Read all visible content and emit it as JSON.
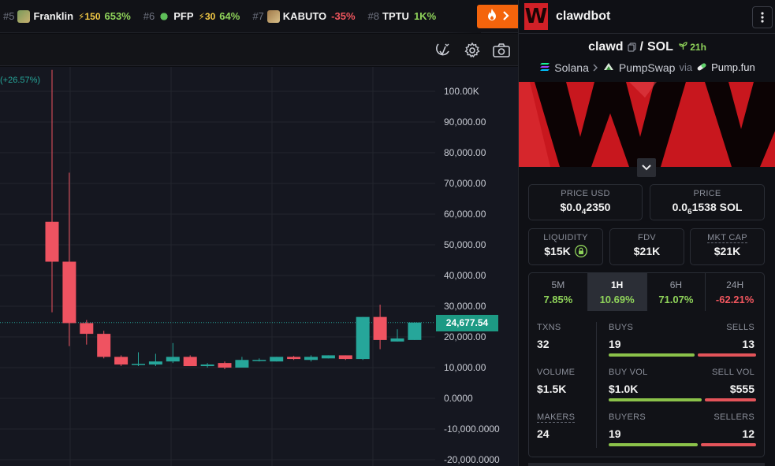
{
  "ticker": {
    "items": [
      {
        "rank": "#5",
        "name": "Franklin",
        "boost": "⚡150",
        "change": "653%",
        "dir": "up",
        "img": "a"
      },
      {
        "rank": "#6",
        "name": "PFP",
        "boost": "⚡30",
        "change": "64%",
        "dir": "up",
        "img": "b"
      },
      {
        "rank": "#7",
        "name": "KABUTO",
        "boost": "",
        "change": "-35%",
        "dir": "down",
        "img": "c"
      },
      {
        "rank": "#8",
        "name": "TPTU",
        "boost": "",
        "change": "1K%",
        "dir": "up",
        "img": ""
      }
    ],
    "trending_icon": "flame-icon",
    "arrow_icon": "chevron-right-icon"
  },
  "toolbar": {
    "icons": [
      "indicator-icon",
      "gear-icon",
      "camera-icon"
    ]
  },
  "chart": {
    "change_label": "(+26.57%)",
    "last_price_label": "24,677.54",
    "colors": {
      "up": "#26a69a",
      "down": "#ef5361",
      "bg": "#151720",
      "grid": "#22252e"
    }
  },
  "chart_data": {
    "type": "candlestick",
    "y_ticks": [
      "100.00K",
      "90,000.00",
      "80,000.00",
      "70,000.00",
      "60,000.00",
      "50,000.00",
      "40,000.00",
      "30,000.00",
      "20,000.00",
      "10,000.00",
      "0.0000",
      "-10,000.0000",
      "-20,000.0000"
    ],
    "y_tick_values": [
      100000,
      90000,
      80000,
      70000,
      60000,
      50000,
      40000,
      30000,
      20000,
      10000,
      0,
      -10000,
      -20000
    ],
    "ylim": [
      -20000,
      100000
    ],
    "last_price": 24677.54,
    "candles": [
      {
        "o": 57500,
        "h": 107000,
        "l": 28000,
        "c": 44500
      },
      {
        "o": 44500,
        "h": 73500,
        "l": 17000,
        "c": 24500
      },
      {
        "o": 24500,
        "h": 25500,
        "l": 17500,
        "c": 21000
      },
      {
        "o": 21000,
        "h": 22000,
        "l": 13000,
        "c": 13500
      },
      {
        "o": 13500,
        "h": 14000,
        "l": 10500,
        "c": 11000
      },
      {
        "o": 11000,
        "h": 15000,
        "l": 10500,
        "c": 11200
      },
      {
        "o": 11000,
        "h": 14500,
        "l": 10500,
        "c": 12000
      },
      {
        "o": 12000,
        "h": 18000,
        "l": 11500,
        "c": 13500
      },
      {
        "o": 13500,
        "h": 14000,
        "l": 10500,
        "c": 10500
      },
      {
        "o": 10500,
        "h": 11500,
        "l": 10000,
        "c": 11000
      },
      {
        "o": 11500,
        "h": 12000,
        "l": 9500,
        "c": 10000
      },
      {
        "o": 10000,
        "h": 13500,
        "l": 10000,
        "c": 12500
      },
      {
        "o": 12500,
        "h": 13000,
        "l": 12000,
        "c": 12500
      },
      {
        "o": 12000,
        "h": 13500,
        "l": 12000,
        "c": 13500
      },
      {
        "o": 13500,
        "h": 13800,
        "l": 12500,
        "c": 12800
      },
      {
        "o": 12500,
        "h": 14000,
        "l": 12000,
        "c": 13500
      },
      {
        "o": 13000,
        "h": 14000,
        "l": 13000,
        "c": 14000
      },
      {
        "o": 14000,
        "h": 14000,
        "l": 12500,
        "c": 12800
      },
      {
        "o": 12800,
        "h": 26500,
        "l": 12500,
        "c": 26500
      },
      {
        "o": 26500,
        "h": 30500,
        "l": 16000,
        "c": 19000
      },
      {
        "o": 18500,
        "h": 22500,
        "l": 18500,
        "c": 19500
      },
      {
        "o": 19000,
        "h": 24700,
        "l": 19000,
        "c": 24677
      }
    ]
  },
  "side": {
    "title": "clawdbot",
    "logo_letter": "W",
    "pair": {
      "base": "clawd",
      "sep": "/",
      "quote": "SOL",
      "age": "21h"
    },
    "crumbs": {
      "chain": "Solana",
      "dex": "PumpSwap",
      "via": "via",
      "launchpad": "Pump.fun"
    },
    "price_usd": {
      "label": "PRICE USD",
      "pre": "$0.0",
      "sub": "4",
      "post": "2350"
    },
    "price": {
      "label": "PRICE",
      "pre": "0.0",
      "sub": "6",
      "post": "1538 SOL"
    },
    "liquidity": {
      "label": "LIQUIDITY",
      "value": "$15K"
    },
    "fdv": {
      "label": "FDV",
      "value": "$21K"
    },
    "mktcap": {
      "label": "MKT CAP",
      "value": "$21K"
    },
    "periods": [
      {
        "label": "5M",
        "value": "7.85%",
        "dir": "up"
      },
      {
        "label": "1H",
        "value": "10.69%",
        "dir": "up",
        "active": true
      },
      {
        "label": "6H",
        "value": "71.07%",
        "dir": "up"
      },
      {
        "label": "24H",
        "value": "-62.21%",
        "dir": "down"
      }
    ],
    "stats": {
      "txns": {
        "label": "TXNS",
        "value": "32"
      },
      "buys": {
        "label": "BUYS",
        "value": "19"
      },
      "sells": {
        "label": "SELLS",
        "value": "13"
      },
      "volume": {
        "label": "VOLUME",
        "value": "$1.5K"
      },
      "buy_vol": {
        "label": "BUY VOL",
        "value": "$1.0K"
      },
      "sell_vol": {
        "label": "SELL VOL",
        "value": "$555"
      },
      "makers": {
        "label": "MAKERS",
        "value": "24"
      },
      "buyers": {
        "label": "BUYERS",
        "value": "19"
      },
      "sellers": {
        "label": "SELLERS",
        "value": "12"
      }
    },
    "ratios": {
      "buys": 0.594,
      "buy_vol": 0.643,
      "buyers": 0.613
    }
  }
}
